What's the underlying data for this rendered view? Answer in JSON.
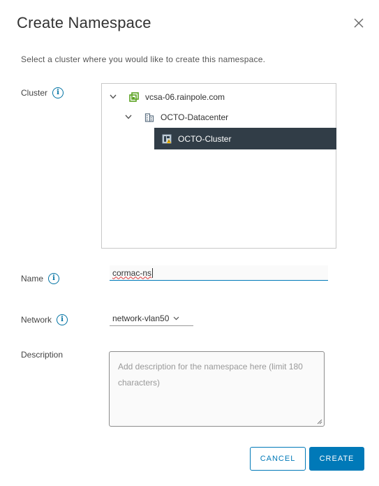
{
  "dialog": {
    "title": "Create Namespace",
    "subtitle": "Select a cluster where you would like to create this namespace."
  },
  "cluster": {
    "label": "Cluster",
    "tree": [
      {
        "label": "vcsa-06.rainpole.com",
        "icon": "vcenter-icon",
        "expanded": true
      },
      {
        "label": "OCTO-Datacenter",
        "icon": "datacenter-icon",
        "expanded": true
      },
      {
        "label": "OCTO-Cluster",
        "icon": "cluster-icon",
        "selected": true
      }
    ]
  },
  "name": {
    "label": "Name",
    "value": "cormac-ns"
  },
  "network": {
    "label": "Network",
    "value": "network-vlan50"
  },
  "description": {
    "label": "Description",
    "placeholder": "Add description for the namespace here (limit 180 characters)"
  },
  "buttons": {
    "cancel": "CANCEL",
    "create": "CREATE"
  },
  "colors": {
    "accent": "#0079b8",
    "selected_row": "#313d47"
  }
}
